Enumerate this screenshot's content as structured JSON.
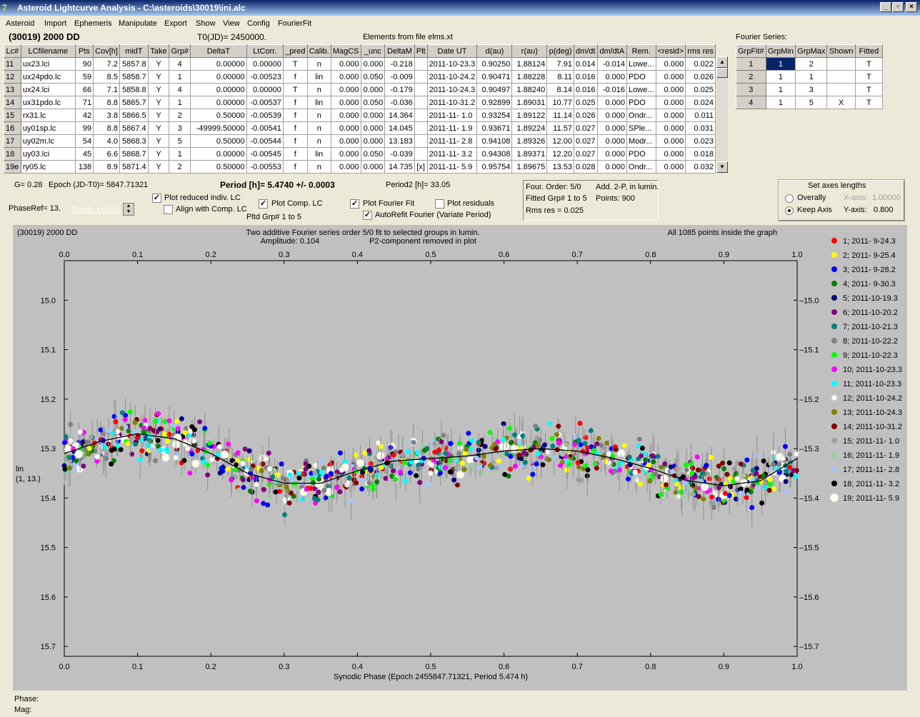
{
  "window": {
    "title": "Asteroid Lightcurve Analysis - C:\\asteroids\\30019\\ini.alc",
    "icon_text": "7"
  },
  "menu": [
    "Asteroid",
    "Import",
    "Ephemeris",
    "Manipulate",
    "Export",
    "Show",
    "View",
    "Config",
    "FourierFit"
  ],
  "header": {
    "object": "(30019) 2000 DD",
    "t0": "T0(JD)= 2450000.",
    "elements": "Elements from file elms.xt",
    "fourier_title": "Fourier Series:"
  },
  "lc_table": {
    "columns": [
      "Lc#",
      "LCfilename",
      "Pts",
      "Cov[h]",
      "midT",
      "Take",
      "Grp#",
      "DeltaT",
      "LtCorr.",
      "_pred",
      "Calib.",
      "MagCS",
      "_unc",
      "DeltaM",
      "Plt",
      "Date UT",
      "d(au)",
      "r(au)",
      "p(deg)",
      "dm/dt",
      "dm/dtA",
      "Rem.",
      "<resid>",
      "rms res"
    ],
    "rows": [
      [
        "11",
        "ux23.lci",
        "90",
        "7.2",
        "5857.8",
        "Y",
        "4",
        "0.00000",
        "0.00000",
        "T",
        "n",
        "0.000",
        "0.000",
        "-0.218",
        "",
        "2011-10-23.3",
        "0.90250",
        "1.88124",
        "7.91",
        "0.014",
        "-0.014",
        "Lowe...",
        "0.000",
        "0.022"
      ],
      [
        "12",
        "ux24pdo.lc",
        "59",
        "8.5",
        "5858.7",
        "Y",
        "1",
        "0.00000",
        "-0.00523",
        "f",
        "lin",
        "0.000",
        "0.050",
        "-0.009",
        "",
        "2011-10-24.2",
        "0.90471",
        "1.88228",
        "8.11",
        "0.016",
        "0.000",
        "PDO",
        "0.000",
        "0.026"
      ],
      [
        "13",
        "ux24.lci",
        "66",
        "7.1",
        "5858.8",
        "Y",
        "4",
        "0.00000",
        "0.00000",
        "T",
        "n",
        "0.000",
        "0.000",
        "-0.179",
        "",
        "2011-10-24.3",
        "0.90497",
        "1.88240",
        "8.14",
        "0.016",
        "-0.016",
        "Lowe...",
        "0.000",
        "0.025"
      ],
      [
        "14",
        "ux31pdo.lc",
        "71",
        "8.8",
        "5865.7",
        "Y",
        "1",
        "0.00000",
        "-0.00537",
        "f",
        "lin",
        "0.000",
        "0.050",
        "-0.036",
        "",
        "2011-10-31.2",
        "0.92899",
        "1.89031",
        "10.77",
        "0.025",
        "0.000",
        "PDO",
        "0.000",
        "0.024"
      ],
      [
        "15",
        "rx31.lc",
        "42",
        "3.8",
        "5866.5",
        "Y",
        "2",
        "0.50000",
        "-0.00539",
        "f",
        "n",
        "0.000",
        "0.000",
        "14.364",
        "",
        "2011-11- 1.0",
        "0.93254",
        "1.89122",
        "11.14",
        "0.026",
        "0.000",
        "Ondr...",
        "0.000",
        "0.011"
      ],
      [
        "16",
        "uy01sp.lc",
        "99",
        "8.8",
        "5867.4",
        "Y",
        "3",
        "-49999.50000",
        "-0.00541",
        "f",
        "n",
        "0.000",
        "0.000",
        "14.045",
        "",
        "2011-11- 1.9",
        "0.93671",
        "1.89224",
        "11.57",
        "0.027",
        "0.000",
        "SPle...",
        "0.000",
        "0.031"
      ],
      [
        "17",
        "uy02m.lc",
        "54",
        "4.0",
        "5868.3",
        "Y",
        "5",
        "0.50000",
        "-0.00544",
        "f",
        "n",
        "0.000",
        "0.000",
        "13.183",
        "",
        "2011-11- 2.8",
        "0.94108",
        "1.89326",
        "12.00",
        "0.027",
        "0.000",
        "Modr...",
        "0.000",
        "0.023"
      ],
      [
        "18",
        "uy03.lci",
        "45",
        "6.6",
        "5868.7",
        "Y",
        "1",
        "0.00000",
        "-0.00545",
        "f",
        "lin",
        "0.000",
        "0.050",
        "-0.039",
        "",
        "2011-11- 3.2",
        "0.94308",
        "1.89371",
        "12.20",
        "0.027",
        "0.000",
        "PDO",
        "0.000",
        "0.018"
      ],
      [
        "19e",
        "ry05.lc",
        "138",
        "8.9",
        "5871.4",
        "Y",
        "2",
        "0.50000",
        "-0.00553",
        "f",
        "n",
        "0.000",
        "0.000",
        "14.735",
        "[x]",
        "2011-11- 5.9",
        "0.95754",
        "1.89675",
        "13.53",
        "0.028",
        "0.000",
        "Ondr...",
        "0.000",
        "0.032"
      ]
    ]
  },
  "fourier_table": {
    "columns": [
      "GrpFit#",
      "GrpMin",
      "GrpMax",
      "Shown",
      "Fitted"
    ],
    "rows": [
      [
        "1",
        "1",
        "2",
        "",
        "T"
      ],
      [
        "2",
        "1",
        "1",
        "",
        "T"
      ],
      [
        "3",
        "1",
        "3",
        "",
        "T"
      ],
      [
        "4",
        "1",
        "5",
        "X",
        "T"
      ]
    ]
  },
  "controls": {
    "g": "G= 0.28",
    "epoch": "Epoch (JD-T0)= 5847.71321",
    "period": "Period [h]= 5.4740 +/- 0.0003",
    "period2": "Period2 [h]= 33.05",
    "phaseref": "PhaseRef= 13.",
    "emph": "Emph. Lc#19:",
    "plot_reduced": "Plot reduced indiv. LC",
    "align": "Align with Comp. LC",
    "plot_comp": "Plot Comp. LC",
    "plot_fourier": "Plot Fourier Fit",
    "plot_resid": "Plot residuals",
    "autorefit": "AutoRefit Fourier (Variate Period)",
    "pltd": "Pltd Grp#  1   to   5",
    "info1": "Four. Order:  5/0",
    "info2": "Add. 2-P, in lumin.",
    "info3": "Fitted Grp# 1 to 5",
    "info4": "Points: 900",
    "info5": "Rms res     = 0.025",
    "axes_title": "Set axes lengths",
    "overally": "Overally",
    "keep": "Keep Axis",
    "xaxis": "X-axis:",
    "xval": "1.00000",
    "yaxis": "Y-axis:",
    "yval": "0.800"
  },
  "chart_data": {
    "type": "scatter",
    "title_left": "(30019) 2000 DD",
    "title": "Two additive Fourier series order 5/0 fit to selected groups in lumin.",
    "subtitle_amp": "Amplitude: 0.104",
    "subtitle_p2": "P2-component removed in plot",
    "note_right": "All 1085 points inside the graph",
    "xlabel": "Synodic Phase (Epoch 2455847.71321, Period 5.474 h)",
    "ylabel": "lin",
    "ylabel2": "(1, 13.)",
    "xlim": [
      0,
      1
    ],
    "ylim": [
      15.72,
      14.92
    ],
    "xticks": [
      "0.0",
      "0.1",
      "0.2",
      "0.3",
      "0.4",
      "0.5",
      "0.6",
      "0.7",
      "0.8",
      "0.9",
      "1.0"
    ],
    "yticks": [
      "15.0",
      "15.1",
      "15.2",
      "15.3",
      "15.4",
      "15.5",
      "15.6",
      "15.7"
    ],
    "fit_curve": {
      "x": [
        0,
        0.05,
        0.1,
        0.15,
        0.2,
        0.25,
        0.3,
        0.35,
        0.4,
        0.45,
        0.5,
        0.55,
        0.6,
        0.65,
        0.7,
        0.75,
        0.8,
        0.85,
        0.9,
        0.95,
        1.0
      ],
      "y": [
        15.31,
        15.285,
        15.27,
        15.28,
        15.31,
        15.35,
        15.37,
        15.37,
        15.345,
        15.325,
        15.32,
        15.315,
        15.305,
        15.3,
        15.305,
        15.32,
        15.34,
        15.365,
        15.375,
        15.365,
        15.32
      ]
    },
    "legend": [
      {
        "label": "1; 2011- 9-24.3",
        "color": "#ff0000"
      },
      {
        "label": "2; 2011- 9-25.4",
        "color": "#ffff00"
      },
      {
        "label": "3; 2011- 9-28.2",
        "color": "#0000ff"
      },
      {
        "label": "4; 2011- 9-30.3",
        "color": "#008000"
      },
      {
        "label": "5; 2011-10-19.3",
        "color": "#000080"
      },
      {
        "label": "6; 2011-10-20.2",
        "color": "#800080"
      },
      {
        "label": "7; 2011-10-21.3",
        "color": "#008080"
      },
      {
        "label": "8; 2011-10-22.2",
        "color": "#808080"
      },
      {
        "label": "9; 2011-10-22.3",
        "color": "#00ff00"
      },
      {
        "label": "10; 2011-10-23.3",
        "color": "#ff00ff"
      },
      {
        "label": "11; 2011-10-23.3",
        "color": "#00ffff"
      },
      {
        "label": "12; 2011-10-24.2",
        "color": "#ffffff"
      },
      {
        "label": "13; 2011-10-24.3",
        "color": "#808000"
      },
      {
        "label": "14; 2011-10-31.2",
        "color": "#800000"
      },
      {
        "label": "15; 2011-11- 1.0",
        "color": "#a0a0a0"
      },
      {
        "label": "16; 2011-11- 1.9",
        "color": "#a0c8a0"
      },
      {
        "label": "17; 2011-11- 2.8",
        "color": "#a0c8ff"
      },
      {
        "label": "18; 2011-11- 3.2",
        "color": "#000000"
      },
      {
        "label": "19; 2011-11- 5.9",
        "color": "#fffff0"
      }
    ],
    "points_in_graph": 1085
  },
  "status": {
    "phase": "Phase:",
    "mag": "Mag:"
  }
}
